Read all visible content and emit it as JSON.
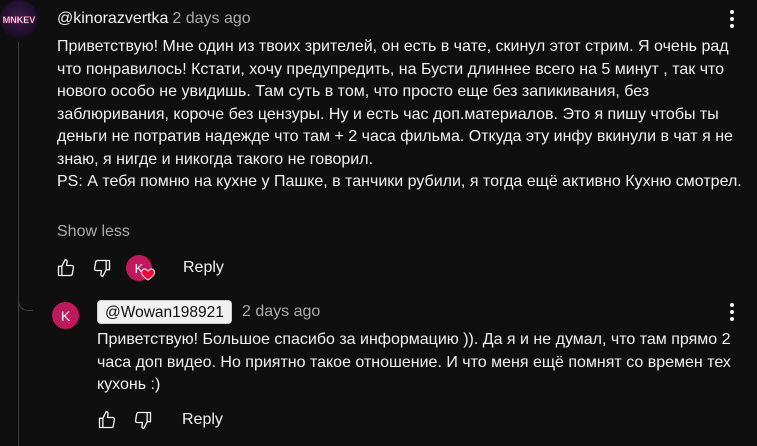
{
  "comment": {
    "handle": "@kinorazvertka",
    "time": "2 days ago",
    "avatar_text": "MNKEV",
    "text": "Приветствую! Мне один из твоих зрителей, он есть в чате, скинул этот стрим. Я очень рад что понравилось! Кстати, хочу предупредить, на Бусти длиннее всего на 5 минут , так что нового особо не увидишь. Там суть в том, что просто еще без запикивания, без заблюривания, короче без цензуры. Ну и есть час доп.материалов. Это я пишу чтобы ты деньги не потратив надежде что там + 2 часа фильма. Откуда эту инфу вкинули в чат я не знаю, я нигде и никогда такого не говорил.\nPS: А тебя помню на кухне у Пашке, в танчики рубили, я тогда ещё активно Кухню смотрел.",
    "show_less": "Show less",
    "creator_heart_initial": "K",
    "reply_label": "Reply"
  },
  "reply": {
    "avatar_initial": "K",
    "mention": "@Wowan198921",
    "time": "2 days ago",
    "text": "Приветствую! Большое спасибо за информацию )). Да я и не думал, что там прямо 2 часа доп видео. Но приятно такое отношение. И что меня ещё помнят со времен тех кухонь :)",
    "reply_label": "Reply"
  },
  "colors": {
    "background": "#0f0f0f",
    "text": "#f1f1f1",
    "secondary": "#aaaaaa",
    "avatar_pink": "#c2185b",
    "heart_red": "#ff0033"
  }
}
